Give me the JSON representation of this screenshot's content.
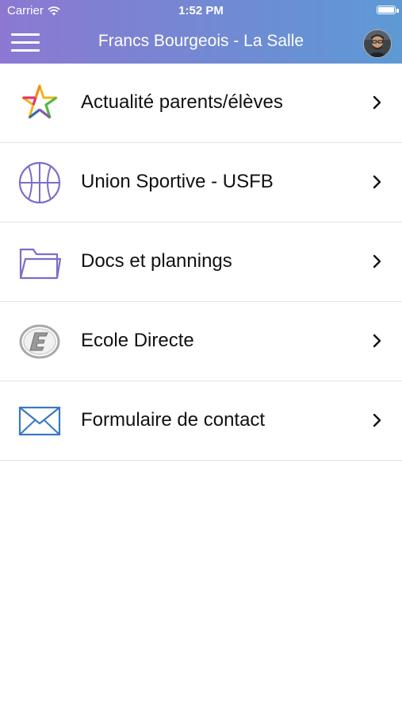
{
  "status_bar": {
    "carrier": "Carrier",
    "time": "1:52 PM"
  },
  "nav_bar": {
    "title": "Francs Bourgeois - La Salle",
    "menu_icon": "hamburger-menu-icon",
    "avatar_icon": "user-avatar"
  },
  "colors": {
    "header_gradient_start": "#8c78d2",
    "header_gradient_end": "#5d9ad4",
    "row_text": "#111111",
    "icon_purple": "#7a6fc9",
    "icon_blue": "#3a78c2"
  },
  "menu": {
    "items": [
      {
        "label": "Actualité parents/élèves",
        "icon": "star-icon"
      },
      {
        "label": "Union Sportive - USFB",
        "icon": "basketball-icon"
      },
      {
        "label": "Docs et plannings",
        "icon": "folder-icon"
      },
      {
        "label": "Ecole Directe",
        "icon": "ecole-directe-logo-icon"
      },
      {
        "label": "Formulaire de contact",
        "icon": "envelope-icon"
      }
    ]
  }
}
